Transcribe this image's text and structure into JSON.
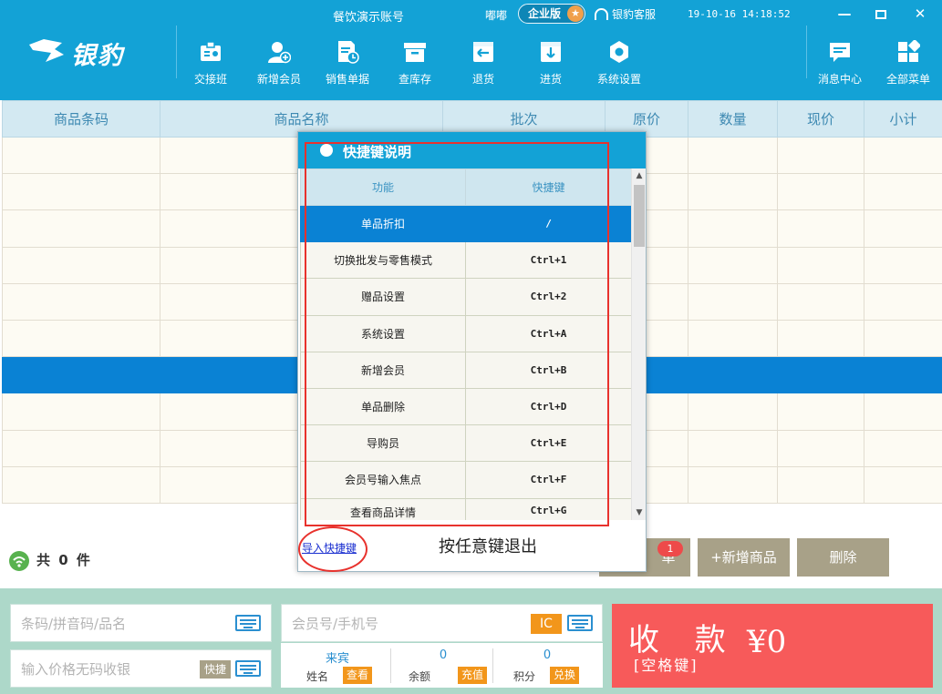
{
  "window": {
    "title": "餐饮演示账号",
    "user": "嘟嘟",
    "edition": "企业版",
    "service": "银豹客服",
    "datetime": "19-10-16 14:18:52",
    "minimize": "—",
    "close": "✕"
  },
  "logo": {
    "text": "银豹"
  },
  "toolbar": {
    "items": [
      {
        "label": "交接班",
        "icon": "shift-handover-icon"
      },
      {
        "label": "新增会员",
        "icon": "add-member-icon"
      },
      {
        "label": "销售单据",
        "icon": "sales-receipt-icon"
      },
      {
        "label": "查库存",
        "icon": "inventory-box-icon"
      },
      {
        "label": "退货",
        "icon": "return-goods-icon"
      },
      {
        "label": "进货",
        "icon": "purchase-in-icon"
      },
      {
        "label": "系统设置",
        "icon": "settings-gear-icon"
      }
    ],
    "right_items": [
      {
        "label": "消息中心",
        "icon": "message-center-icon"
      },
      {
        "label": "全部菜单",
        "icon": "all-menu-icon"
      }
    ]
  },
  "product_table": {
    "columns": [
      "商品条码",
      "商品名称",
      "批次",
      "原价",
      "数量",
      "现价",
      "小计"
    ],
    "row_count": 10,
    "selected_row": 6
  },
  "summary": {
    "count_text": "共 0 件"
  },
  "actions": {
    "order_label": "单",
    "order_badge": "1",
    "add_product": "+新增商品",
    "delete": "删除"
  },
  "inputs": {
    "barcode_placeholder": "条码/拼音码/品名",
    "price_placeholder": "输入价格无码收银",
    "quick_label": "快捷",
    "member_placeholder": "会员号/手机号",
    "ic_label": "IC"
  },
  "member": {
    "name_value": "来宾",
    "name_label": "姓名",
    "name_action": "查看",
    "balance_value": "0",
    "balance_label": "余额",
    "balance_action": "充值",
    "points_value": "0",
    "points_label": "积分",
    "points_action": "兑换"
  },
  "checkout": {
    "label": "收 款",
    "hint": "[空格键]",
    "amount": "¥0"
  },
  "shortcut_dialog": {
    "title": "快捷键说明",
    "col_function": "功能",
    "col_key": "快捷键",
    "rows": [
      {
        "func": "单品折扣",
        "key": "/"
      },
      {
        "func": "切换批发与零售模式",
        "key": "Ctrl+1"
      },
      {
        "func": "赠品设置",
        "key": "Ctrl+2"
      },
      {
        "func": "系统设置",
        "key": "Ctrl+A"
      },
      {
        "func": "新增会员",
        "key": "Ctrl+B"
      },
      {
        "func": "单品删除",
        "key": "Ctrl+D"
      },
      {
        "func": "导购员",
        "key": "Ctrl+E"
      },
      {
        "func": "会员号输入焦点",
        "key": "Ctrl+F"
      },
      {
        "func": "查看商品详情",
        "key": "Ctrl+G"
      }
    ],
    "import_link": "导入快捷键",
    "exit_hint": "按任意键退出"
  }
}
